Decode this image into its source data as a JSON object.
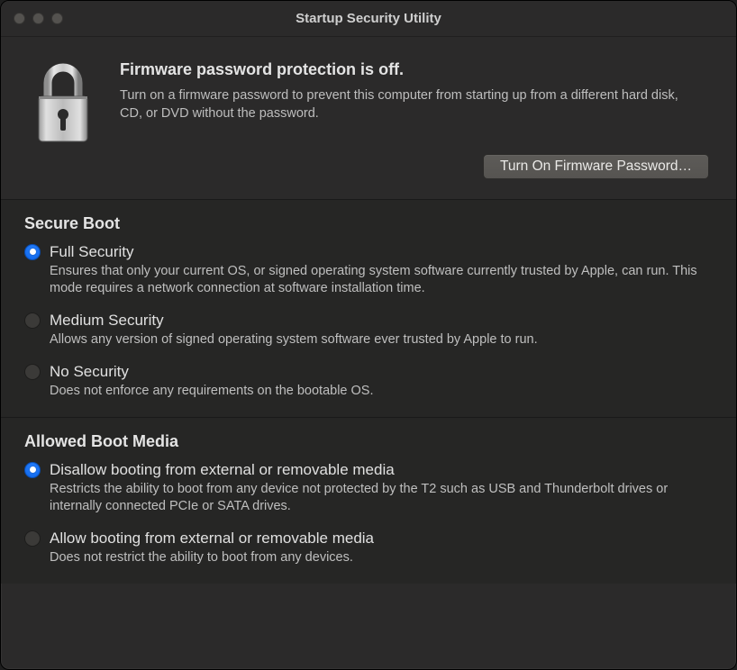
{
  "window": {
    "title": "Startup Security Utility"
  },
  "header": {
    "title": "Firmware password protection is off.",
    "description": "Turn on a firmware password to prevent this computer from starting up from a different hard disk, CD, or DVD without the password.",
    "button_label": "Turn On Firmware Password…"
  },
  "secure_boot": {
    "title": "Secure Boot",
    "options": [
      {
        "label": "Full Security",
        "description": "Ensures that only your current OS, or signed operating system software currently trusted by Apple, can run. This mode requires a network connection at software installation time.",
        "selected": true
      },
      {
        "label": "Medium Security",
        "description": "Allows any version of signed operating system software ever trusted by Apple to run.",
        "selected": false
      },
      {
        "label": "No Security",
        "description": "Does not enforce any requirements on the bootable OS.",
        "selected": false
      }
    ]
  },
  "boot_media": {
    "title": "Allowed Boot Media",
    "options": [
      {
        "label": "Disallow booting from external or removable media",
        "description": "Restricts the ability to boot from any device not protected by the T2 such as USB and Thunderbolt drives or internally connected PCIe or SATA drives.",
        "selected": true
      },
      {
        "label": "Allow booting from external or removable media",
        "description": "Does not restrict the ability to boot from any devices.",
        "selected": false
      }
    ]
  }
}
